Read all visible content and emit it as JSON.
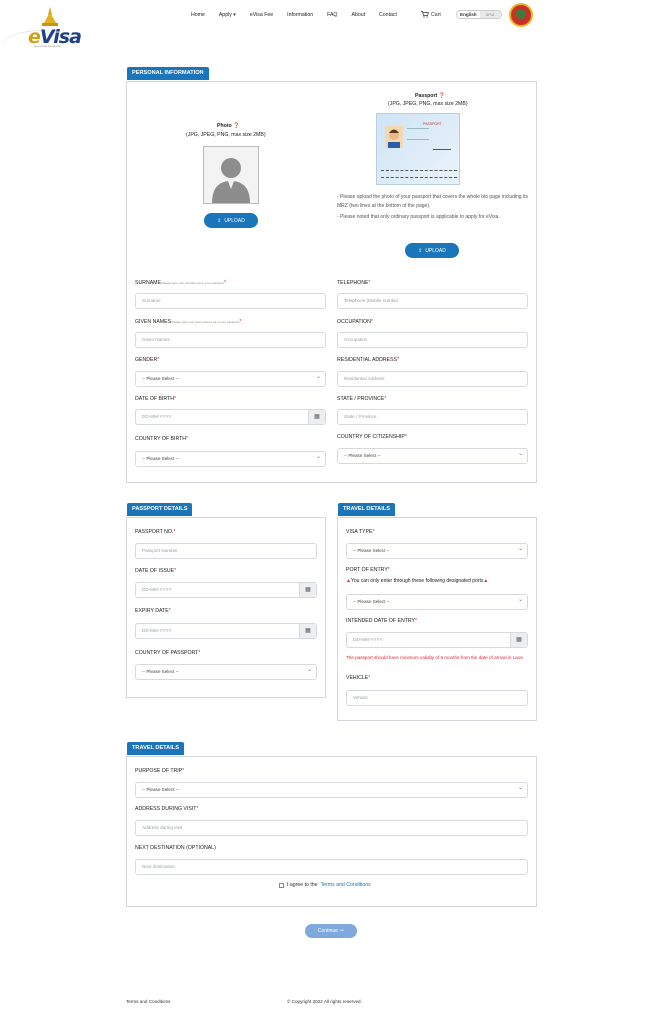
{
  "brand": {
    "logo_text": "eVisa",
    "tagline": "LAO OFFICIAL ONLINE VISA"
  },
  "nav": {
    "items": [
      "Home",
      "Apply",
      "eVisa Fee",
      "Information",
      "FAQ",
      "About",
      "Contact"
    ],
    "cart": "Cart",
    "lang_en": "English",
    "lang_lo": "ລາວ"
  },
  "personal": {
    "tab": "PERSONAL INFORMATION",
    "photo_title": "Photo",
    "photo_hint": "(JPG, JPEG, PNG, max size 2MB)",
    "passport_title": "Passport",
    "passport_hint": "(JPG, JPEG, PNG, max size 2MB)",
    "upload": "UPLOAD",
    "note1": "- Please upload the photo of your passport that covers the whole bio page including its MRZ (two lines at the bottom of the page).",
    "note2": "- Please noted that only ordinary passport is applicable to apply for eVisa.",
    "surname_label": "SURNAME",
    "surname_hint": "(Please type your surname as in your passport)",
    "surname_ph": "Surname",
    "given_label": "GIVEN NAMES",
    "given_hint": "(Please type your given names as in your passport)",
    "given_ph": "Given Names",
    "gender_label": "GENDER",
    "gender_value": "-- Please Select --",
    "dob_label": "DATE OF BIRTH",
    "dob_ph": "DD-MM-YYYY",
    "cob_label": "COUNTRY OF BIRTH",
    "cob_value": "-- Please Select --",
    "tel_label": "TELEPHONE",
    "tel_ph": "Telephone (Mobile number",
    "occ_label": "OCCUPATION",
    "occ_ph": "Occupation",
    "res_label": "RESIDENTIAL ADDRESS",
    "res_ph": "Residential Address",
    "state_label": "STATE / PROVINCE",
    "state_ph": "State / Province",
    "coc_label": "COUNTRY OF CITIZENSHIP",
    "coc_value": "-- Please Select --",
    "passport_sample": "PASSPORT"
  },
  "passport_details": {
    "tab": "PASSPORT DETAILS",
    "no_label": "PASSPORT NO.",
    "no_ph": "Passport Number",
    "issue_label": "DATE OF ISSUE",
    "issue_ph": "DD-MM-YYYY",
    "expiry_label": "EXPIRY DATE",
    "expiry_ph": "DD-MM-YYYY",
    "country_label": "COUNTRY OF PASSPORT",
    "country_value": "-- Please Select --"
  },
  "travel_right": {
    "tab": "TRAVEL DETAILS",
    "visa_label": "VISA TYPE",
    "visa_value": "-- Please Select --",
    "port_label": "PORT OF ENTRY",
    "port_note": "You can only enter through these following designated ports",
    "port_value": "-- Please Select --",
    "entry_label": "INTENDED DATE OF ENTRY",
    "entry_ph": "DD-MM-YYYY",
    "validity_warning": "The passport should have minimum validity of 6 months from the date of arrival in Laos.",
    "vehicle_label": "VEHICLE",
    "vehicle_ph": "Vehicle"
  },
  "travel": {
    "tab": "TRAVEL DETAILS",
    "purpose_label": "PURPOSE OF TRIP",
    "purpose_value": "-- Please Select --",
    "address_label": "ADDRESS DURING VISIT",
    "address_ph": "Address during visit",
    "next_label": "NEXT DESTINATION (OPTIONAL)",
    "next_ph": "Next destination",
    "agree_text": "I agree to the",
    "agree_link": "Terms and Conditions"
  },
  "actions": {
    "continue": "Continue"
  },
  "footer": {
    "terms": "Terms and Conditions",
    "copyright": "© Copyright 2022 All rights reserved."
  },
  "colors": {
    "primary": "#1b75bb",
    "required": "#d9262c",
    "continue": "#7fa9dc"
  }
}
